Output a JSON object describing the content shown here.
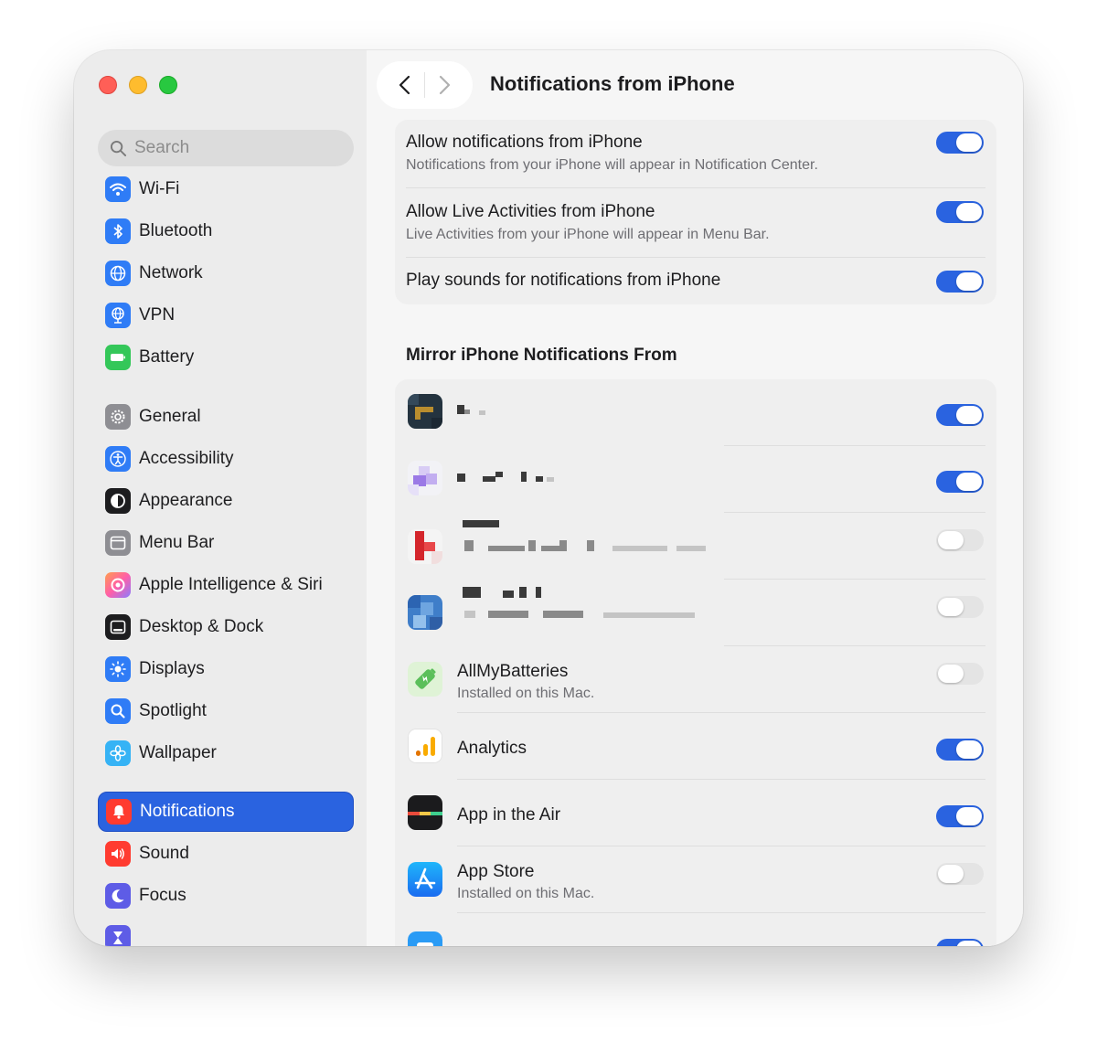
{
  "window": {
    "title": "Notifications from iPhone"
  },
  "sidebar": {
    "search_placeholder": "Search",
    "items": [
      {
        "label": "Wi-Fi",
        "icon": "wifi-icon",
        "color": "#2f7cf6"
      },
      {
        "label": "Bluetooth",
        "icon": "bluetooth-icon",
        "color": "#2f7cf6"
      },
      {
        "label": "Network",
        "icon": "globe-icon",
        "color": "#2f7cf6"
      },
      {
        "label": "VPN",
        "icon": "vpn-globe-icon",
        "color": "#2f7cf6"
      },
      {
        "label": "Battery",
        "icon": "battery-icon",
        "color": "#34c759"
      },
      {
        "label": "General",
        "icon": "gear-icon",
        "color": "#8e8e93"
      },
      {
        "label": "Accessibility",
        "icon": "accessibility-icon",
        "color": "#2f7cf6"
      },
      {
        "label": "Appearance",
        "icon": "appearance-icon",
        "color": "#1d1d1f"
      },
      {
        "label": "Menu Bar",
        "icon": "menu-bar-icon",
        "color": "#8e8e93"
      },
      {
        "label": "Apple Intelligence & Siri",
        "icon": "siri-icon",
        "color": "#ff7ab6"
      },
      {
        "label": "Desktop & Dock",
        "icon": "dock-icon",
        "color": "#1d1d1f"
      },
      {
        "label": "Displays",
        "icon": "sun-icon",
        "color": "#2f7cf6"
      },
      {
        "label": "Spotlight",
        "icon": "spotlight-icon",
        "color": "#2f7cf6"
      },
      {
        "label": "Wallpaper",
        "icon": "flower-icon",
        "color": "#36b3f5"
      },
      {
        "label": "Notifications",
        "icon": "bell-icon",
        "color": "#ff3b30"
      },
      {
        "label": "Sound",
        "icon": "speaker-icon",
        "color": "#ff3b30"
      },
      {
        "label": "Focus",
        "icon": "moon-icon",
        "color": "#5e5ce6"
      }
    ],
    "active_item": "Notifications"
  },
  "settings": [
    {
      "title": "Allow notifications from iPhone",
      "subtitle": "Notifications from your iPhone will appear in Notification Center.",
      "enabled": true
    },
    {
      "title": "Allow Live Activities from iPhone",
      "subtitle": "Live Activities from your iPhone will appear in Menu Bar.",
      "enabled": true
    },
    {
      "title": "Play sounds for notifications from iPhone",
      "subtitle": "",
      "enabled": true
    }
  ],
  "mirror": {
    "header": "Mirror iPhone Notifications From",
    "apps": [
      {
        "name": "",
        "subtitle": "",
        "enabled": true,
        "redacted": true
      },
      {
        "name": "",
        "subtitle": "",
        "enabled": true,
        "redacted": true
      },
      {
        "name": "",
        "subtitle": "",
        "enabled": false,
        "redacted": true
      },
      {
        "name": "",
        "subtitle": "",
        "enabled": false,
        "redacted": true
      },
      {
        "name": "AllMyBatteries",
        "subtitle": "Installed on this Mac.",
        "enabled": false,
        "icon": "battery-app-icon"
      },
      {
        "name": "Analytics",
        "subtitle": "",
        "enabled": true,
        "icon": "analytics-icon"
      },
      {
        "name": "App in the Air",
        "subtitle": "",
        "enabled": true,
        "icon": "app-in-the-air-icon"
      },
      {
        "name": "App Store",
        "subtitle": "Installed on this Mac.",
        "enabled": false,
        "icon": "app-store-icon"
      }
    ]
  },
  "colors": {
    "accent": "#2a63e0",
    "toggle_off": "#e4e4e4"
  }
}
